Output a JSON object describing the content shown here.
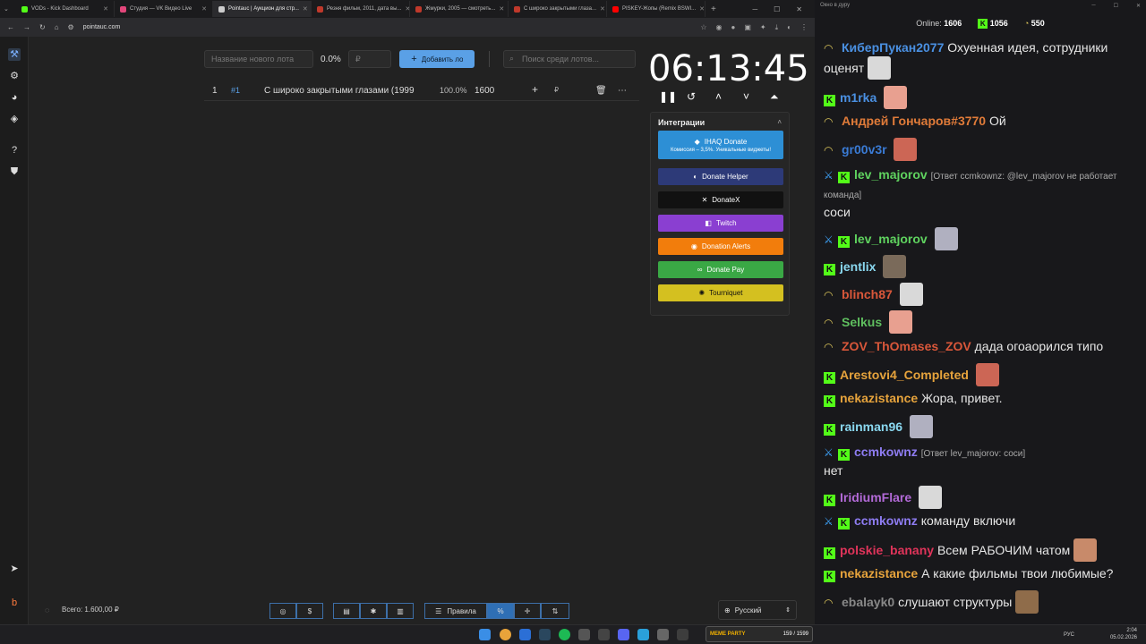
{
  "browser": {
    "tabs": [
      {
        "label": "VODs - Kick Dashboard",
        "color": "#53fc18"
      },
      {
        "label": "Студия — VK Видео Live",
        "color": "#e2467a"
      },
      {
        "label": "Pointauc | Аукцион для стр...",
        "color": "#cccccc",
        "active": true
      },
      {
        "label": "Резня фильм, 2011, дата вы...",
        "color": "#c0392b"
      },
      {
        "label": "Жмурки, 2005 — смотреть...",
        "color": "#c0392b"
      },
      {
        "label": "С широко закрытыми глаза...",
        "color": "#c0392b"
      },
      {
        "label": "PISKEY-Жопы (Remix BSWI...",
        "color": "#ff0000"
      }
    ],
    "url": "pointauc.com"
  },
  "auction": {
    "new_lot_placeholder": "Название нового лота",
    "percent": "0.0%",
    "currency_placeholder": "₽",
    "add_button": "Добавить лот",
    "search_placeholder": "Поиск среди лотов...",
    "lots": [
      {
        "index": "1",
        "tag": "#1",
        "name": "С широко закрытыми глазами (1999",
        "percent": "100.0%",
        "amount": "1600",
        "currency": "₽"
      }
    ],
    "timer": "06:13:45",
    "integrations_title": "Интеграции",
    "integrations": [
      {
        "label": "IHAQ Donate",
        "sub": "Комиссия – 3,5%. Уникальные виджеты!",
        "color": "#2d8fd5"
      },
      {
        "label": "Donate Helper",
        "color": "#2d3a78"
      },
      {
        "label": "DonateX",
        "color": "#111111"
      },
      {
        "label": "Twitch",
        "color": "#8a3fd1"
      },
      {
        "label": "Donation Alerts",
        "color": "#f27d0c"
      },
      {
        "label": "Donate Pay",
        "color": "#3aa845"
      },
      {
        "label": "Tourniquet",
        "color": "#d4c020"
      }
    ],
    "total_label": "Всего: 1.600,00 ₽",
    "rules_button": "Правила",
    "language": "Русский"
  },
  "chat": {
    "window_title": "Окно в дуру",
    "online_label": "Online:",
    "online_count": "1606",
    "kick_count": "1056",
    "other_count": "550",
    "messages": [
      {
        "user": "КиберПукан2077",
        "color": "#4a90e2",
        "badge": "sub",
        "text": "Охуенная идея, сотрудники оценят",
        "emote": true
      },
      {
        "user": "m1rka",
        "color": "#4a90e2",
        "badge": "kick",
        "text": "",
        "emote": true
      },
      {
        "user": "Андрей Гончаров#3770",
        "color": "#e07b39",
        "badge": "sub",
        "text": "Ой"
      },
      {
        "user": "gr00v3r",
        "color": "#3a7bd5",
        "badge": "sub",
        "text": "",
        "emote": true
      },
      {
        "user": "lev_majorov",
        "color": "#5fd35f",
        "badge": "mod",
        "reply": "[Ответ ccmkownz: @lev_majorov не работает команда]",
        "text": "соси"
      },
      {
        "user": "lev_majorov",
        "color": "#5fd35f",
        "badge": "mod",
        "text": "",
        "emote": true
      },
      {
        "user": "jentlix",
        "color": "#8ad8f0",
        "badge": "kick",
        "text": "",
        "emote": true
      },
      {
        "user": "blinch87",
        "color": "#d9573a",
        "badge": "sub",
        "text": "",
        "emote": true
      },
      {
        "user": "Selkus",
        "color": "#5fbf5f",
        "badge": "sub",
        "text": "",
        "emote": true
      },
      {
        "user": "ZOV_ThOmases_ZOV",
        "color": "#d9573a",
        "badge": "sub",
        "text": "дада огоаорился типо"
      },
      {
        "user": "Arestovi4_Completed",
        "color": "#e6a33c",
        "badge": "kick",
        "text": "",
        "emote": true
      },
      {
        "user": "nekazistance",
        "color": "#e6a33c",
        "badge": "kick",
        "text": "Жора, привет."
      },
      {
        "user": "rainman96",
        "color": "#8ad8f0",
        "badge": "kick",
        "text": "",
        "emote": true
      },
      {
        "user": "ccmkownz",
        "color": "#8e7cf2",
        "badge": "mod",
        "reply": "[Ответ lev_majorov: соси]",
        "text": "нет"
      },
      {
        "user": "IridiumFlare",
        "color": "#b36ad8",
        "badge": "kick",
        "text": "",
        "emote": true
      },
      {
        "user": "ccmkownz",
        "color": "#8e7cf2",
        "badge": "mod",
        "text": "команду включи"
      },
      {
        "user": "polskie_banany",
        "color": "#e0345a",
        "badge": "kick",
        "text": "Всем РАБОЧИМ чатом",
        "emote": true
      },
      {
        "user": "nekazistance",
        "color": "#e6a33c",
        "badge": "kick",
        "text": "А какие фильмы твои любимые?"
      },
      {
        "user": "ebalayk0",
        "color": "#888888",
        "badge": "sub",
        "text": "слушают структуры",
        "emote": true
      }
    ]
  },
  "taskbar": {
    "media_label": "MEME PARTY",
    "media_count": "159 / 1599",
    "lang": "РУС",
    "time": "2:04",
    "date": "05.02.2026"
  }
}
